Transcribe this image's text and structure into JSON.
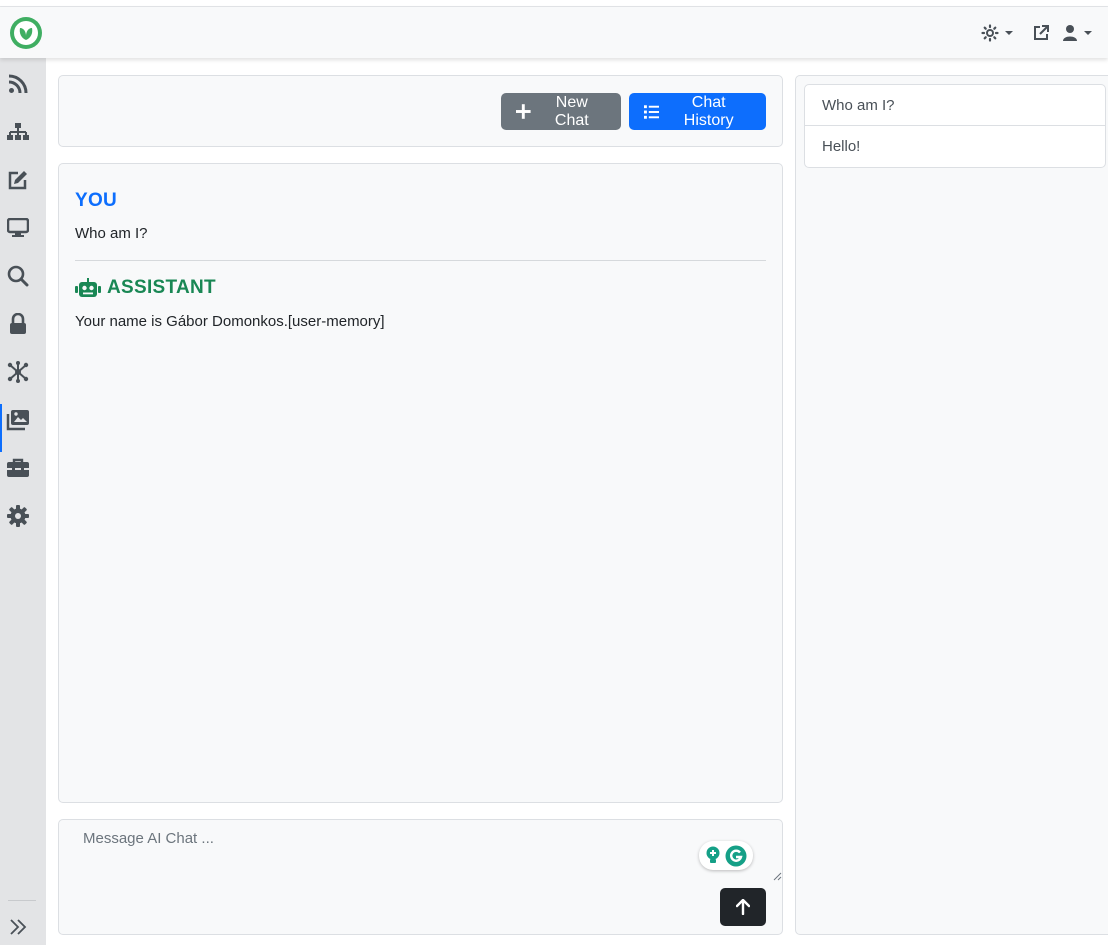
{
  "header": {
    "logo_icon": "leaf-logo-icon",
    "icons": [
      "brightness-icon",
      "external-link-icon",
      "user-icon"
    ]
  },
  "sidebar": {
    "items": [
      {
        "icon": "rss-icon"
      },
      {
        "icon": "sitemap-icon"
      },
      {
        "icon": "edit-icon"
      },
      {
        "icon": "monitor-icon"
      },
      {
        "icon": "search-icon"
      },
      {
        "icon": "lock-icon"
      },
      {
        "icon": "network-icon",
        "active": true
      },
      {
        "icon": "images-icon"
      },
      {
        "icon": "toolbox-icon"
      },
      {
        "icon": "gear-icon"
      }
    ],
    "expand_icon": "chevron-double-right-icon"
  },
  "toolbar": {
    "new_chat_label": "New Chat",
    "chat_history_label": "Chat History"
  },
  "conversation": {
    "messages": [
      {
        "role": "YOU",
        "text": "Who am I?"
      },
      {
        "role": "ASSISTANT",
        "text": "Your name is Gábor Domonkos.[user-memory]"
      }
    ]
  },
  "composer": {
    "placeholder": "Message AI Chat ..."
  },
  "history": {
    "items": [
      "Who am I?",
      "Hello!"
    ]
  },
  "colors": {
    "primary": "#0d6efd",
    "secondary": "#6c757d",
    "assistant": "#198754",
    "user": "#0d6efd",
    "logo": "#3fae62"
  }
}
